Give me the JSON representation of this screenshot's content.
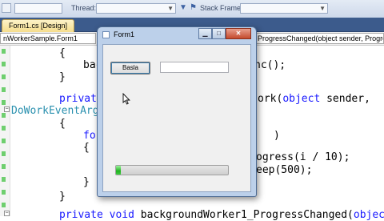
{
  "toolbar": {
    "thread_label": "Thread:",
    "stack_frame_label": "Stack Frame:"
  },
  "tabs": [
    {
      "label": "Form1.cs [Design]"
    }
  ],
  "navbar": {
    "class_combo": "nWorkerSample.Form1",
    "member_combo": "ProgressChanged(object sender, ProgressChan"
  },
  "code_lines": {
    "l1": "{",
    "l2_a": "bac",
    "l2_b": "nc();",
    "l3": "}",
    "l4_kw": "private",
    "l4_b": "ork(",
    "l4_obj": "object",
    "l4_c": " sender,",
    "l5_type": "DoWorkEventArgs",
    "l6": "{",
    "l7_kw": "for",
    "l7_b": ")",
    "l8": "{",
    "l9": "ogress(i / 10);",
    "l10": "eep(500);",
    "l11": "}",
    "l12": "}",
    "l13_kw1": "private",
    "l13_kw2": "void",
    "l13_rest": " backgroundWorker1_ProgressChanged(",
    "l13_obj": "object"
  },
  "form_window": {
    "title": "Form1",
    "start_button_label": "Basla",
    "textbox_value": "",
    "progress_percent": 4,
    "minimize_icon": "minimize-icon",
    "maximize_icon": "maximize-icon",
    "close_icon": "close-icon"
  },
  "colors": {
    "keyword": "#1a1aff",
    "type": "#2b91af",
    "progress": "#22b022",
    "tab_active": "#f5dd8c"
  }
}
